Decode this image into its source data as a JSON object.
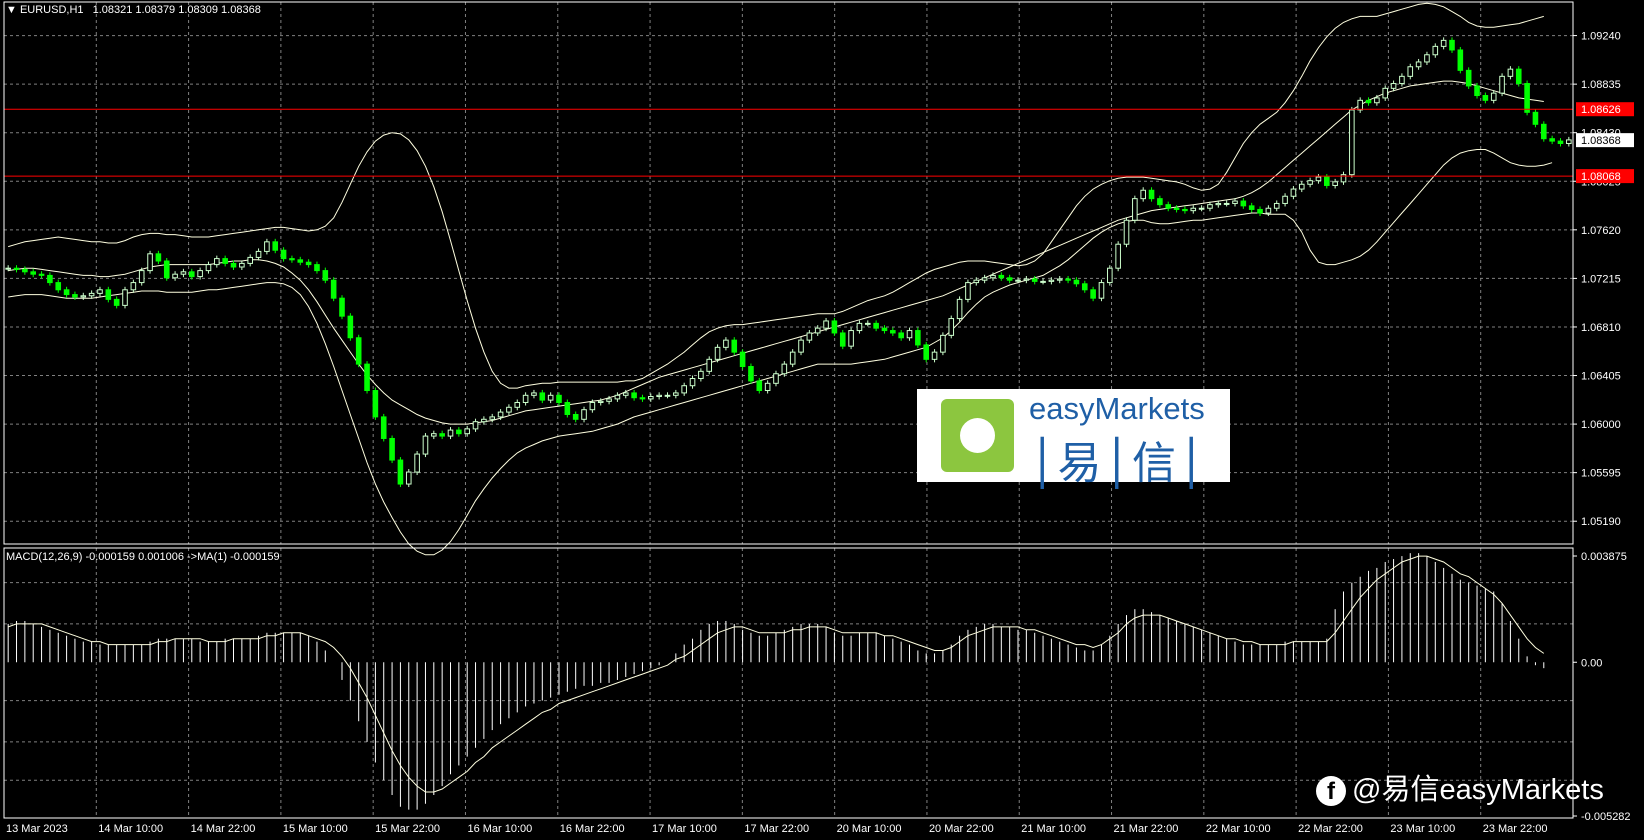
{
  "header": {
    "symbol_label": "EURUSD,H1",
    "ohlc": "1.08321 1.08379 1.08309 1.08368",
    "macd_label": "MACD(12,26,9) -0.000159 0.001006 ->MA(1) -0.000159"
  },
  "watermark": {
    "brand": "easyMarkets",
    "cn": "│易│信│"
  },
  "social": {
    "text": "@易信easyMarkets",
    "icon": "facebook-icon"
  },
  "colors": {
    "background": "#000000",
    "grid": "#808080",
    "bull_candle": "#ccffcc",
    "bear_candle": "#00ff00",
    "band": "#ffffe0",
    "level_line": "#ff0000",
    "macd": "#ffffff"
  },
  "chart_data": [
    {
      "type": "candlestick",
      "symbol": "EURUSD",
      "timeframe": "H1",
      "x_ticks": [
        "13 Mar 2023",
        "14 Mar 10:00",
        "14 Mar 22:00",
        "15 Mar 10:00",
        "15 Mar 22:00",
        "16 Mar 10:00",
        "16 Mar 22:00",
        "17 Mar 10:00",
        "17 Mar 22:00",
        "20 Mar 10:00",
        "20 Mar 22:00",
        "21 Mar 10:00",
        "21 Mar 22:00",
        "22 Mar 10:00",
        "22 Mar 22:00",
        "23 Mar 10:00",
        "23 Mar 22:00"
      ],
      "y_ticks": [
        "1.09240",
        "1.08835",
        "1.08430",
        "1.08025",
        "1.07620",
        "1.07215",
        "1.06810",
        "1.06405",
        "1.06000",
        "1.05595",
        "1.05190"
      ],
      "ylim": [
        1.05,
        1.0952
      ],
      "current_price": "1.08368",
      "horizontal_levels": [
        "1.08626",
        "1.08068"
      ],
      "close": [
        1.073,
        1.0729,
        1.0727,
        1.0725,
        1.0724,
        1.0718,
        1.0712,
        1.0708,
        1.0706,
        1.0707,
        1.0709,
        1.0712,
        1.0704,
        1.0699,
        1.0712,
        1.0718,
        1.0728,
        1.0742,
        1.0736,
        1.0722,
        1.0725,
        1.0727,
        1.0723,
        1.0728,
        1.0733,
        1.0738,
        1.0734,
        1.0731,
        1.0734,
        1.0739,
        1.0744,
        1.0752,
        1.0745,
        1.0738,
        1.0737,
        1.0735,
        1.0733,
        1.0728,
        1.072,
        1.0705,
        1.069,
        1.0672,
        1.065,
        1.0628,
        1.0606,
        1.0588,
        1.057,
        1.055,
        1.056,
        1.0575,
        1.059,
        1.0592,
        1.059,
        1.0595,
        1.0592,
        1.0596,
        1.0602,
        1.0604,
        1.0606,
        1.061,
        1.0614,
        1.0618,
        1.0624,
        1.0626,
        1.062,
        1.0624,
        1.0618,
        1.0608,
        1.0604,
        1.0612,
        1.0618,
        1.0619,
        1.0621,
        1.0624,
        1.0626,
        1.0622,
        1.0621,
        1.0623,
        1.0624,
        1.0624,
        1.0626,
        1.0632,
        1.0638,
        1.0644,
        1.0654,
        1.0664,
        1.067,
        1.066,
        1.0648,
        1.0636,
        1.0628,
        1.0634,
        1.0642,
        1.065,
        1.066,
        1.067,
        1.0676,
        1.068,
        1.0686,
        1.0676,
        1.0665,
        1.0678,
        1.0684,
        1.0684,
        1.068,
        1.0678,
        1.0676,
        1.0672,
        1.0678,
        1.0666,
        1.0654,
        1.066,
        1.0674,
        1.0688,
        1.0704,
        1.0718,
        1.072,
        1.0722,
        1.0724,
        1.0722,
        1.072,
        1.072,
        1.0721,
        1.0719,
        1.0719,
        1.072,
        1.0721,
        1.072,
        1.0717,
        1.0712,
        1.0705,
        1.0718,
        1.073,
        1.075,
        1.077,
        1.0788,
        1.0795,
        1.0788,
        1.0783,
        1.078,
        1.0779,
        1.0778,
        1.078,
        1.078,
        1.0783,
        1.0784,
        1.0784,
        1.0786,
        1.0782,
        1.0779,
        1.0776,
        1.078,
        1.0784,
        1.079,
        1.0796,
        1.08,
        1.0803,
        1.0806,
        1.0799,
        1.0802,
        1.0808,
        1.0862,
        1.087,
        1.0868,
        1.0872,
        1.088,
        1.0884,
        1.089,
        1.0898,
        1.0902,
        1.0908,
        1.0915,
        1.092,
        1.0912,
        1.0895,
        1.0882,
        1.0874,
        1.087,
        1.0876,
        1.089,
        1.0896,
        1.0884,
        1.086,
        1.085,
        1.0838,
        1.0836,
        1.0834,
        1.0837
      ],
      "upper_band": [
        1.0748,
        1.075,
        1.0752,
        1.0753,
        1.0754,
        1.0755,
        1.0756,
        1.0755,
        1.0754,
        1.0753,
        1.0752,
        1.0752,
        1.0751,
        1.0751,
        1.0753,
        1.0756,
        1.0758,
        1.0759,
        1.0759,
        1.0758,
        1.0758,
        1.0757,
        1.0756,
        1.0756,
        1.0756,
        1.0757,
        1.0758,
        1.0759,
        1.076,
        1.0761,
        1.0762,
        1.0763,
        1.0764,
        1.0764,
        1.0763,
        1.0762,
        1.0761,
        1.0762,
        1.0765,
        1.0772,
        1.0785,
        1.08,
        1.0815,
        1.0827,
        1.0836,
        1.0841,
        1.0843,
        1.0842,
        1.0837,
        1.0828,
        1.0815,
        1.0798,
        1.0777,
        1.0753,
        1.0728,
        1.0703,
        1.068,
        1.066,
        1.0644,
        1.0634,
        1.063,
        1.063,
        1.0632,
        1.0633,
        1.0634,
        1.0634,
        1.0635,
        1.0635,
        1.0635,
        1.0635,
        1.0635,
        1.0635,
        1.0635,
        1.0635,
        1.0636,
        1.0636,
        1.0638,
        1.0642,
        1.0646,
        1.065,
        1.0655,
        1.066,
        1.0666,
        1.0672,
        1.0677,
        1.068,
        1.0682,
        1.0683,
        1.0683,
        1.0684,
        1.0685,
        1.0686,
        1.0687,
        1.0688,
        1.0689,
        1.069,
        1.0691,
        1.0692,
        1.0692,
        1.0692,
        1.0694,
        1.0697,
        1.07,
        1.0703,
        1.0705,
        1.0707,
        1.071,
        1.0714,
        1.0718,
        1.0722,
        1.0726,
        1.0729,
        1.0731,
        1.0733,
        1.0735,
        1.0736,
        1.0736,
        1.0736,
        1.0735,
        1.0734,
        1.0733,
        1.0732,
        1.0733,
        1.0736,
        1.0742,
        1.0752,
        1.0762,
        1.0772,
        1.0782,
        1.079,
        1.0796,
        1.08,
        1.0803,
        1.0805,
        1.0806,
        1.0806,
        1.0806,
        1.0805,
        1.0804,
        1.0803,
        1.0802,
        1.08,
        1.0797,
        1.0795,
        1.0796,
        1.08,
        1.081,
        1.0822,
        1.0834,
        1.0843,
        1.085,
        1.0855,
        1.086,
        1.0868,
        1.0878,
        1.089,
        1.0903,
        1.0914,
        1.0923,
        1.093,
        1.0935,
        1.0938,
        1.094,
        1.094,
        1.094,
        1.0942,
        1.0944,
        1.0946,
        1.0948,
        1.095,
        1.0951,
        1.095,
        1.0948,
        1.0944,
        1.094,
        1.0935,
        1.0932,
        1.0931,
        1.0931,
        1.0932,
        1.0933,
        1.0934,
        1.0936,
        1.0938,
        1.094
      ],
      "middle_band": [
        1.0728,
        1.0729,
        1.073,
        1.073,
        1.0729,
        1.0728,
        1.0727,
        1.0726,
        1.0725,
        1.0724,
        1.0724,
        1.0723,
        1.0723,
        1.0724,
        1.0725,
        1.0727,
        1.0729,
        1.0731,
        1.0732,
        1.0733,
        1.0733,
        1.0733,
        1.0733,
        1.0733,
        1.0733,
        1.0734,
        1.0735,
        1.0736,
        1.0736,
        1.0737,
        1.0737,
        1.0736,
        1.0734,
        1.0731,
        1.0726,
        1.072,
        1.0712,
        1.0702,
        1.0691,
        1.068,
        1.067,
        1.066,
        1.065,
        1.0641,
        1.0633,
        1.0626,
        1.062,
        1.0616,
        1.0612,
        1.0608,
        1.0605,
        1.0603,
        1.0601,
        1.06,
        1.06,
        1.06,
        1.0601,
        1.0602,
        1.0603,
        1.0605,
        1.0607,
        1.0609,
        1.0611,
        1.0612,
        1.0613,
        1.0614,
        1.0615,
        1.0616,
        1.0617,
        1.0618,
        1.0619,
        1.062,
        1.0622,
        1.0624,
        1.0627,
        1.063,
        1.0633,
        1.0636,
        1.0639,
        1.0641,
        1.0643,
        1.0645,
        1.0647,
        1.0649,
        1.0651,
        1.0653,
        1.0655,
        1.0657,
        1.0659,
        1.0661,
        1.0663,
        1.0665,
        1.0667,
        1.0669,
        1.0671,
        1.0673,
        1.0675,
        1.0677,
        1.0679,
        1.0681,
        1.0683,
        1.0685,
        1.0687,
        1.0689,
        1.0691,
        1.0693,
        1.0695,
        1.0697,
        1.0699,
        1.0701,
        1.0703,
        1.0705,
        1.0707,
        1.071,
        1.0713,
        1.0716,
        1.0719,
        1.0722,
        1.0725,
        1.0728,
        1.0731,
        1.0734,
        1.0737,
        1.074,
        1.0743,
        1.0746,
        1.0749,
        1.0752,
        1.0755,
        1.0758,
        1.0761,
        1.0764,
        1.0767,
        1.077,
        1.0772,
        1.0774,
        1.0776,
        1.0778,
        1.0779,
        1.078,
        1.0781,
        1.0782,
        1.0783,
        1.0784,
        1.0785,
        1.0786,
        1.0787,
        1.0788,
        1.079,
        1.0793,
        1.0797,
        1.0802,
        1.0808,
        1.0814,
        1.082,
        1.0826,
        1.0832,
        1.0838,
        1.0844,
        1.085,
        1.0856,
        1.0862,
        1.0866,
        1.087,
        1.0873,
        1.0876,
        1.0878,
        1.088,
        1.0882,
        1.0883,
        1.0884,
        1.0885,
        1.0886,
        1.0886,
        1.0885,
        1.0884,
        1.0882,
        1.088,
        1.0878,
        1.0876,
        1.0874,
        1.0872,
        1.0871,
        1.087,
        1.0869
      ],
      "lower_band": [
        1.0706,
        1.0707,
        1.0708,
        1.0708,
        1.0708,
        1.0707,
        1.0706,
        1.0705,
        1.0705,
        1.0705,
        1.0705,
        1.0706,
        1.0707,
        1.0708,
        1.0709,
        1.071,
        1.0711,
        1.0711,
        1.0711,
        1.071,
        1.071,
        1.071,
        1.071,
        1.0711,
        1.0712,
        1.0712,
        1.0713,
        1.0714,
        1.0715,
        1.0716,
        1.0717,
        1.0718,
        1.0718,
        1.0717,
        1.0714,
        1.0708,
        1.0698,
        1.0684,
        1.0667,
        1.0648,
        1.0628,
        1.0608,
        1.0588,
        1.0568,
        1.055,
        1.0535,
        1.0522,
        1.051,
        1.05,
        1.0494,
        1.0491,
        1.0491,
        1.0495,
        1.0502,
        1.0512,
        1.0524,
        1.0536,
        1.0546,
        1.0555,
        1.0563,
        1.057,
        1.0576,
        1.058,
        1.0583,
        1.0586,
        1.0588,
        1.059,
        1.0591,
        1.0592,
        1.0593,
        1.0594,
        1.0596,
        1.0598,
        1.06,
        1.0603,
        1.0606,
        1.0608,
        1.061,
        1.0612,
        1.0614,
        1.0616,
        1.0618,
        1.062,
        1.0622,
        1.0624,
        1.0626,
        1.0628,
        1.063,
        1.0632,
        1.0634,
        1.0636,
        1.0638,
        1.064,
        1.0642,
        1.0644,
        1.0646,
        1.0648,
        1.065,
        1.065,
        1.065,
        1.065,
        1.065,
        1.0651,
        1.0652,
        1.0653,
        1.0654,
        1.0656,
        1.0658,
        1.066,
        1.0662,
        1.0664,
        1.0668,
        1.0672,
        1.0678,
        1.0685,
        1.0693,
        1.07,
        1.0706,
        1.071,
        1.0713,
        1.0716,
        1.0718,
        1.072,
        1.0722,
        1.0724,
        1.0728,
        1.0732,
        1.0737,
        1.0743,
        1.0749,
        1.0755,
        1.076,
        1.0764,
        1.0767,
        1.0769,
        1.077,
        1.077,
        1.0768,
        1.0767,
        1.0767,
        1.0768,
        1.0769,
        1.077,
        1.077,
        1.0771,
        1.0772,
        1.0773,
        1.0774,
        1.0775,
        1.0776,
        1.0776,
        1.0775,
        1.0775,
        1.0775,
        1.077,
        1.076,
        1.0745,
        1.0735,
        1.0733,
        1.0733,
        1.0735,
        1.0737,
        1.074,
        1.0745,
        1.0752,
        1.076,
        1.0768,
        1.0776,
        1.0784,
        1.0792,
        1.08,
        1.0808,
        1.0816,
        1.0822,
        1.0826,
        1.0828,
        1.0829,
        1.0829,
        1.0826,
        1.0822,
        1.0818,
        1.0816,
        1.0815,
        1.0815,
        1.0816,
        1.0818
      ]
    },
    {
      "type": "histogram",
      "name": "MACD(12,26,9)",
      "y_ticks": [
        "0.003875",
        "0.00",
        "-0.005282"
      ],
      "ylim": [
        -0.005282,
        0.003875
      ],
      "signal_label": "->MA(1)",
      "values": [
        0.0013,
        0.0014,
        0.0014,
        0.0013,
        0.0012,
        0.0011,
        0.001,
        0.0009,
        0.0008,
        0.0007,
        0.0007,
        0.0006,
        0.0006,
        0.0006,
        0.0006,
        0.0006,
        0.0006,
        0.0007,
        0.0008,
        0.0008,
        0.0008,
        0.0008,
        0.0008,
        0.0007,
        0.0007,
        0.0007,
        0.0008,
        0.0008,
        0.0008,
        0.0008,
        0.0009,
        0.001,
        0.001,
        0.001,
        0.001,
        0.001,
        0.0009,
        0.0007,
        0.0004,
        0.0,
        -0.0006,
        -0.0013,
        -0.002,
        -0.0027,
        -0.0034,
        -0.004,
        -0.0045,
        -0.0049,
        -0.005,
        -0.005,
        -0.0048,
        -0.0045,
        -0.0042,
        -0.0038,
        -0.0035,
        -0.0032,
        -0.0029,
        -0.0026,
        -0.0023,
        -0.0021,
        -0.0019,
        -0.0017,
        -0.0015,
        -0.0014,
        -0.0013,
        -0.0012,
        -0.0011,
        -0.001,
        -0.0009,
        -0.0008,
        -0.0008,
        -0.0007,
        -0.0007,
        -0.0006,
        -0.0005,
        -0.0004,
        -0.0003,
        -0.0002,
        -0.0001,
        0.0,
        0.0003,
        0.0006,
        0.0008,
        0.0011,
        0.0013,
        0.0014,
        0.0014,
        0.0013,
        0.0011,
        0.001,
        0.0009,
        0.0009,
        0.001,
        0.0011,
        0.0012,
        0.0013,
        0.0013,
        0.0013,
        0.0012,
        0.001,
        0.0009,
        0.0009,
        0.001,
        0.001,
        0.001,
        0.0009,
        0.0008,
        0.0007,
        0.0006,
        0.0004,
        0.0003,
        0.0003,
        0.0004,
        0.0006,
        0.0009,
        0.0011,
        0.0012,
        0.0013,
        0.0013,
        0.0012,
        0.0012,
        0.0011,
        0.0011,
        0.001,
        0.0009,
        0.0008,
        0.0007,
        0.0006,
        0.0005,
        0.0004,
        0.0004,
        0.0006,
        0.0009,
        0.0013,
        0.0016,
        0.0018,
        0.0018,
        0.0017,
        0.0016,
        0.0015,
        0.0014,
        0.0013,
        0.0012,
        0.0011,
        0.001,
        0.0009,
        0.0008,
        0.0007,
        0.0006,
        0.0006,
        0.0006,
        0.0006,
        0.0006,
        0.0007,
        0.0007,
        0.0007,
        0.0007,
        0.0007,
        0.0008,
        0.0018,
        0.0024,
        0.0027,
        0.0029,
        0.0031,
        0.0032,
        0.0034,
        0.0035,
        0.0036,
        0.0037,
        0.0037,
        0.0036,
        0.0034,
        0.0032,
        0.003,
        0.0028,
        0.0027,
        0.0026,
        0.0025,
        0.0024,
        0.002,
        0.0014,
        0.0008,
        0.0002,
        -0.0001,
        -0.0002
      ],
      "signal": [
        0.0012,
        0.0013,
        0.0013,
        0.0013,
        0.0013,
        0.0012,
        0.0011,
        0.001,
        0.0009,
        0.0008,
        0.0007,
        0.0007,
        0.0006,
        0.0006,
        0.0006,
        0.0006,
        0.0006,
        0.0006,
        0.0007,
        0.0007,
        0.0008,
        0.0008,
        0.0008,
        0.0008,
        0.0007,
        0.0007,
        0.0007,
        0.0008,
        0.0008,
        0.0008,
        0.0008,
        0.0009,
        0.0009,
        0.001,
        0.001,
        0.001,
        0.0009,
        0.0008,
        0.0007,
        0.0005,
        0.0002,
        -0.0002,
        -0.0007,
        -0.0012,
        -0.0018,
        -0.0024,
        -0.003,
        -0.0035,
        -0.0039,
        -0.0042,
        -0.0044,
        -0.0044,
        -0.0043,
        -0.0041,
        -0.0039,
        -0.0037,
        -0.0034,
        -0.0032,
        -0.0029,
        -0.0027,
        -0.0025,
        -0.0023,
        -0.0021,
        -0.0019,
        -0.0017,
        -0.0016,
        -0.0014,
        -0.0013,
        -0.0012,
        -0.0011,
        -0.001,
        -0.0009,
        -0.0008,
        -0.0007,
        -0.0006,
        -0.0005,
        -0.0004,
        -0.0003,
        -0.0002,
        -0.0001,
        0.0001,
        0.0002,
        0.0004,
        0.0006,
        0.0008,
        0.001,
        0.0011,
        0.0012,
        0.0012,
        0.0011,
        0.001,
        0.001,
        0.001,
        0.001,
        0.0011,
        0.0011,
        0.0012,
        0.0012,
        0.0012,
        0.0011,
        0.001,
        0.001,
        0.001,
        0.001,
        0.001,
        0.0009,
        0.0009,
        0.0008,
        0.0007,
        0.0006,
        0.0005,
        0.0004,
        0.0004,
        0.0005,
        0.0007,
        0.0009,
        0.001,
        0.0011,
        0.0012,
        0.0012,
        0.0012,
        0.0012,
        0.0011,
        0.0011,
        0.001,
        0.0009,
        0.0008,
        0.0007,
        0.0006,
        0.0006,
        0.0005,
        0.0006,
        0.0008,
        0.001,
        0.0013,
        0.0015,
        0.0016,
        0.0016,
        0.0016,
        0.0015,
        0.0014,
        0.0013,
        0.0012,
        0.0011,
        0.001,
        0.0009,
        0.0008,
        0.0008,
        0.0007,
        0.0007,
        0.0006,
        0.0006,
        0.0006,
        0.0006,
        0.0007,
        0.0007,
        0.0007,
        0.0007,
        0.0007,
        0.001,
        0.0014,
        0.0018,
        0.0022,
        0.0025,
        0.0028,
        0.003,
        0.0032,
        0.0034,
        0.0035,
        0.0036,
        0.0036,
        0.0035,
        0.0034,
        0.0032,
        0.003,
        0.0029,
        0.0027,
        0.0025,
        0.0023,
        0.002,
        0.0016,
        0.0012,
        0.0008,
        0.0005,
        0.0003
      ]
    }
  ]
}
